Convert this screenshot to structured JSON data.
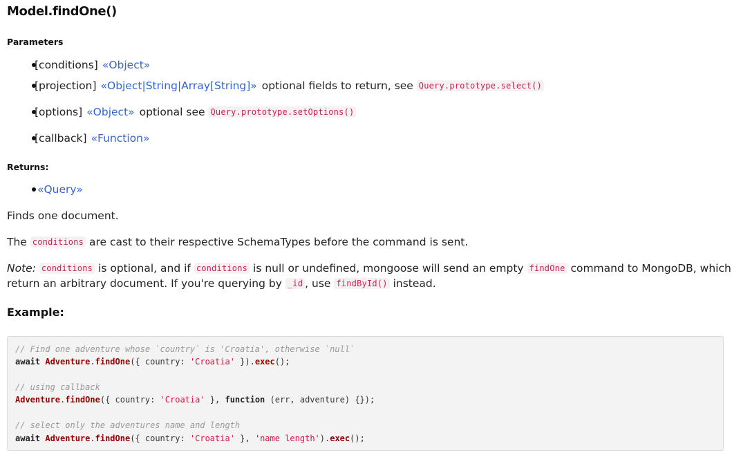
{
  "doc": {
    "title": "Model.findOne()",
    "parameters_label": "Parameters",
    "parameters": [
      {
        "name": "[conditions]",
        "type": "«Object»",
        "desc": "",
        "code": ""
      },
      {
        "name": "[projection]",
        "type": "«Object|String|Array[String]»",
        "desc": "optional fields to return, see",
        "code": "Query.prototype.select()"
      },
      {
        "name": "[options]",
        "type": "«Object»",
        "desc": "optional see",
        "code": "Query.prototype.setOptions()"
      },
      {
        "name": "[callback]",
        "type": "«Function»",
        "desc": "",
        "code": ""
      }
    ],
    "returns_label": "Returns:",
    "returns_type": "«Query»",
    "para1": "Finds one document.",
    "para2": {
      "before": "The",
      "code": "conditions",
      "after": "are cast to their respective SchemaTypes before the command is sent."
    },
    "para3": {
      "note": "Note:",
      "code1": "conditions",
      "text1": "is optional, and if",
      "code2": "conditions",
      "text2": "is null or undefined, mongoose will send an empty",
      "code3": "findOne",
      "text3": "command to MongoDB, which will",
      "text4": "return an arbitrary document. If you're querying by",
      "code4": "_id",
      "text5": ", use",
      "code5": "findById()",
      "text6": "instead."
    },
    "example_label": "Example:",
    "code_lines": {
      "l1": "// Find one adventure whose `country` is 'Croatia', otherwise `null`",
      "l2_kw": "await",
      "l2_obj": "Adventure",
      "l2_fn": "findOne",
      "l2_mid": "({ country: ",
      "l2_str": "'Croatia'",
      "l2_end1": " }).",
      "l2_exec": "exec",
      "l2_end2": "();",
      "l4": "// using callback",
      "l5_obj": "Adventure",
      "l5_fn": "findOne",
      "l5_mid": "({ country: ",
      "l5_str": "'Croatia'",
      "l5_mid2": " }, ",
      "l5_kw": "function",
      "l5_end": " (err, adventure) {});",
      "l7": "// select only the adventures name and length",
      "l8_kw": "await",
      "l8_obj": "Adventure",
      "l8_fn": "findOne",
      "l8_mid": "({ country: ",
      "l8_str": "'Croatia'",
      "l8_mid2": " }, ",
      "l8_str2": "'name length'",
      "l8_end1": ").",
      "l8_exec": "exec",
      "l8_end2": "();"
    }
  },
  "colors": {
    "type_link": "#3366cc",
    "inline_code": "#c7254e",
    "code_bg": "#f3f3f3"
  }
}
